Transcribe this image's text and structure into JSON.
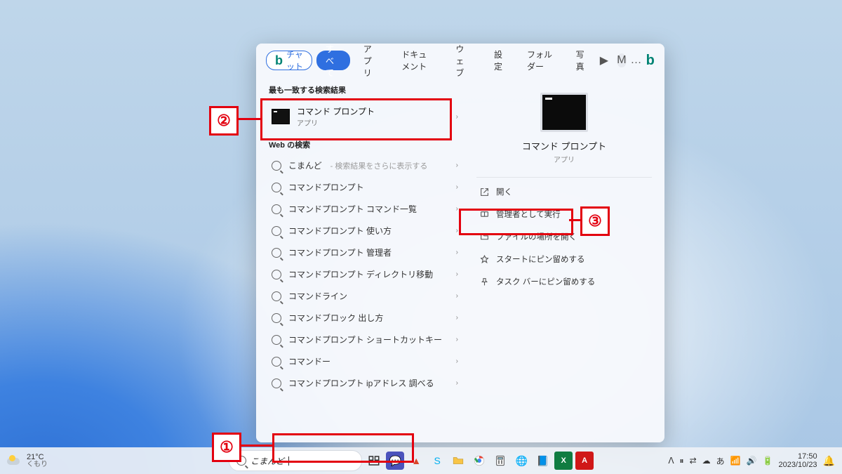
{
  "tabs": {
    "chat": "チャット",
    "all": "すべて",
    "apps": "アプリ",
    "documents": "ドキュメント",
    "web": "ウェブ",
    "settings": "設定",
    "folders": "フォルダー",
    "photos": "写真",
    "play_icon": "▶",
    "avatar_initial": "M",
    "more": "…"
  },
  "sections": {
    "best_match": "最も一致する検索結果",
    "web_search": "Web の検索"
  },
  "best": {
    "title": "コマンド プロンプト",
    "subtitle": "アプリ"
  },
  "web": [
    {
      "label": "こまんど",
      "sub": " - 検索結果をさらに表示する"
    },
    {
      "label": "コマンドプロンプト",
      "sub": ""
    },
    {
      "label": "コマンドプロンプト コマンド一覧",
      "sub": ""
    },
    {
      "label": "コマンドプロンプト 使い方",
      "sub": ""
    },
    {
      "label": "コマンドプロンプト 管理者",
      "sub": ""
    },
    {
      "label": "コマンドプロンプト ディレクトリ移動",
      "sub": ""
    },
    {
      "label": "コマンドライン",
      "sub": ""
    },
    {
      "label": "コマンドブロック 出し方",
      "sub": ""
    },
    {
      "label": "コマンドプロンプト ショートカットキー",
      "sub": ""
    },
    {
      "label": "コマンドー",
      "sub": ""
    },
    {
      "label": "コマンドプロンプト ipアドレス 調べる",
      "sub": ""
    }
  ],
  "preview": {
    "title": "コマンド プロンプト",
    "subtitle": "アプリ"
  },
  "actions": {
    "open": "開く",
    "run_admin": "管理者として実行",
    "open_location": "ファイルの場所を開く",
    "pin_start": "スタートにピン留めする",
    "pin_taskbar": "タスク バーにピン留めする"
  },
  "annotations": {
    "n1": "①",
    "n2": "②",
    "n3": "③"
  },
  "taskbar": {
    "temp": "21°C",
    "weather": "くもり",
    "search_value": "こまんど",
    "ime": "あ",
    "time": "17:50",
    "date": "2023/10/23"
  }
}
